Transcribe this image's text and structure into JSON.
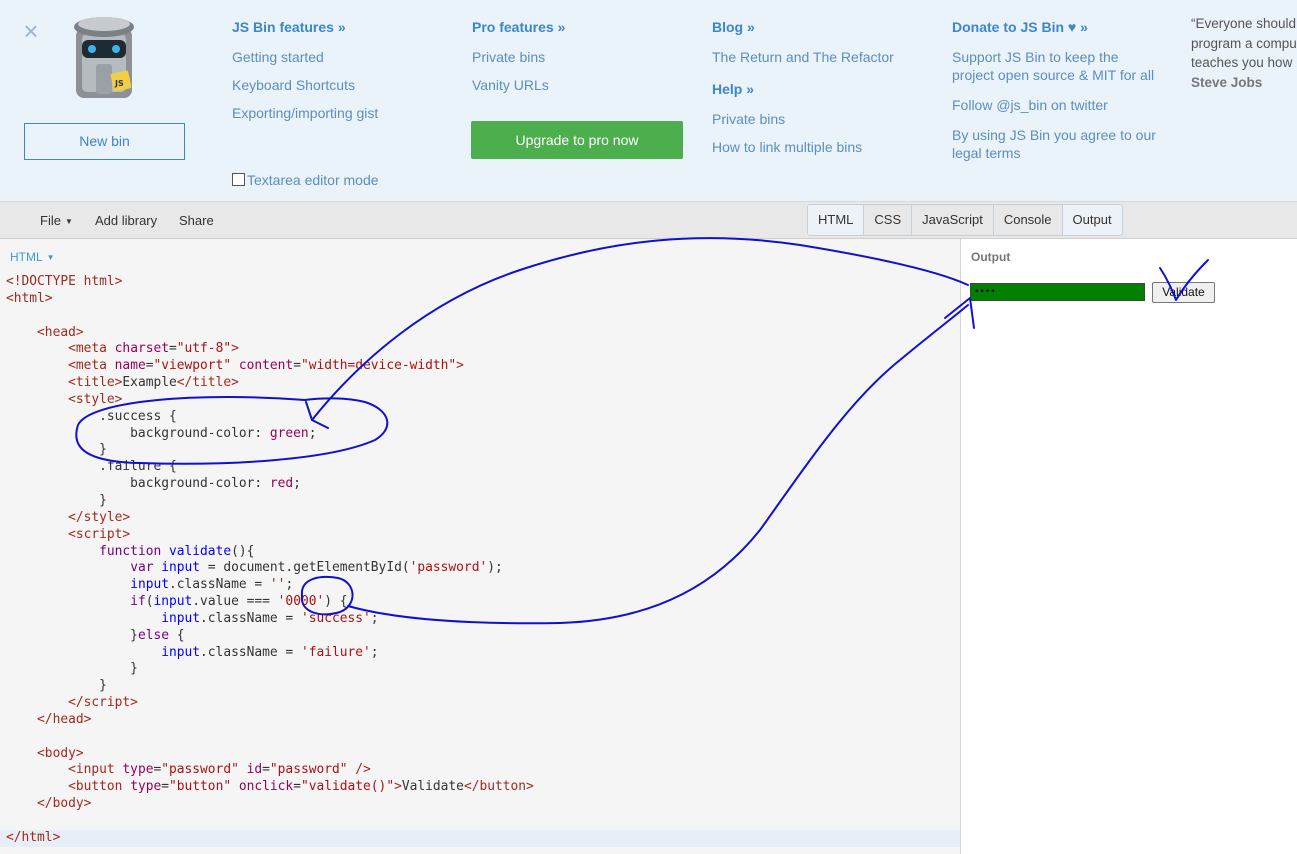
{
  "help_panel": {
    "close_icon": "close-icon",
    "new_bin_label": "New bin",
    "col1": {
      "heading": "JS Bin features »",
      "links": [
        "Getting started",
        "Keyboard Shortcuts",
        "Exporting/importing gist"
      ]
    },
    "textarea_mode_label": "Textarea editor mode",
    "col2": {
      "heading": "Pro features »",
      "links": [
        "Private bins",
        "Vanity URLs"
      ],
      "upgrade_label": "Upgrade to pro now"
    },
    "col3": {
      "heading": "Blog »",
      "links": [
        "The Return and The Refactor"
      ],
      "help_heading": "Help »",
      "help_links": [
        "Private bins",
        "How to link multiple bins"
      ]
    },
    "col4": {
      "heading": "Donate to JS Bin ♥ »",
      "links": [
        "Support JS Bin to keep the project open source & MIT for all",
        "Follow @js_bin on twitter",
        "By using JS Bin you agree to our legal terms"
      ]
    },
    "quote": {
      "lines": [
        "“Everyone should",
        "program a compu",
        "teaches you how"
      ],
      "author": "Steve Jobs"
    }
  },
  "toolbar": {
    "file_label": "File",
    "add_library_label": "Add library",
    "share_label": "Share",
    "tabs": [
      "HTML",
      "CSS",
      "JavaScript",
      "Console",
      "Output"
    ],
    "active_tabs": [
      "HTML",
      "Output"
    ]
  },
  "editor": {
    "panel_label": "HTML"
  },
  "output": {
    "panel_label": "Output",
    "password_value": "••••",
    "validate_label": "Validate"
  },
  "colors": {
    "accent": "#3d87c6",
    "upgrade": "#4cae4c",
    "success_bg": "#008000",
    "annotation": "#1010d0"
  }
}
